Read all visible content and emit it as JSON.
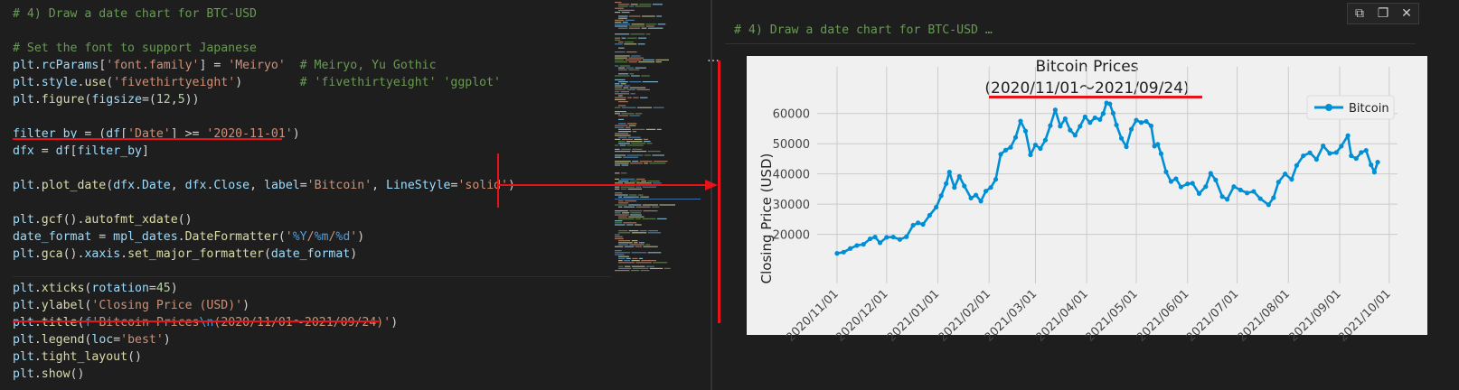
{
  "editor": {
    "lines": [
      [
        {
          "c": "cm",
          "t": "# 4) Draw a date chart for BTC-USD"
        }
      ],
      [],
      [
        {
          "c": "cm",
          "t": "# Set the font to support Japanese"
        }
      ],
      [
        {
          "c": "vr",
          "t": "plt"
        },
        {
          "c": "pl",
          "t": "."
        },
        {
          "c": "vr",
          "t": "rcParams"
        },
        {
          "c": "pl",
          "t": "["
        },
        {
          "c": "st",
          "t": "'font.family'"
        },
        {
          "c": "pl",
          "t": "] = "
        },
        {
          "c": "st",
          "t": "'Meiryo'"
        },
        {
          "c": "pl",
          "t": "  "
        },
        {
          "c": "cm",
          "t": "# Meiryo, Yu Gothic"
        }
      ],
      [
        {
          "c": "vr",
          "t": "plt"
        },
        {
          "c": "pl",
          "t": "."
        },
        {
          "c": "vr",
          "t": "style"
        },
        {
          "c": "pl",
          "t": "."
        },
        {
          "c": "fn",
          "t": "use"
        },
        {
          "c": "pl",
          "t": "("
        },
        {
          "c": "st",
          "t": "'fivethirtyeight'"
        },
        {
          "c": "pl",
          "t": ")        "
        },
        {
          "c": "cm",
          "t": "# 'fivethirtyeight' 'ggplot'"
        }
      ],
      [
        {
          "c": "vr",
          "t": "plt"
        },
        {
          "c": "pl",
          "t": "."
        },
        {
          "c": "fn",
          "t": "figure"
        },
        {
          "c": "pl",
          "t": "("
        },
        {
          "c": "vr",
          "t": "figsize"
        },
        {
          "c": "pl",
          "t": "=("
        },
        {
          "c": "nm",
          "t": "12"
        },
        {
          "c": "pl",
          "t": ","
        },
        {
          "c": "nm",
          "t": "5"
        },
        {
          "c": "pl",
          "t": "))"
        }
      ],
      [],
      [
        {
          "c": "vr",
          "t": "filter_by"
        },
        {
          "c": "pl",
          "t": " = ("
        },
        {
          "c": "vr",
          "t": "df"
        },
        {
          "c": "pl",
          "t": "["
        },
        {
          "c": "st",
          "t": "'Date'"
        },
        {
          "c": "pl",
          "t": "] >= "
        },
        {
          "c": "st",
          "t": "'2020-11-01'"
        },
        {
          "c": "pl",
          "t": ")"
        }
      ],
      [
        {
          "c": "vr",
          "t": "dfx"
        },
        {
          "c": "pl",
          "t": " = "
        },
        {
          "c": "vr",
          "t": "df"
        },
        {
          "c": "pl",
          "t": "["
        },
        {
          "c": "vr",
          "t": "filter_by"
        },
        {
          "c": "pl",
          "t": "]"
        }
      ],
      [],
      [
        {
          "c": "vr",
          "t": "plt"
        },
        {
          "c": "pl",
          "t": "."
        },
        {
          "c": "fn",
          "t": "plot_date"
        },
        {
          "c": "pl",
          "t": "("
        },
        {
          "c": "vr",
          "t": "dfx"
        },
        {
          "c": "pl",
          "t": "."
        },
        {
          "c": "vr",
          "t": "Date"
        },
        {
          "c": "pl",
          "t": ", "
        },
        {
          "c": "vr",
          "t": "dfx"
        },
        {
          "c": "pl",
          "t": "."
        },
        {
          "c": "vr",
          "t": "Close"
        },
        {
          "c": "pl",
          "t": ", "
        },
        {
          "c": "vr",
          "t": "label"
        },
        {
          "c": "pl",
          "t": "="
        },
        {
          "c": "st",
          "t": "'Bitcoin'"
        },
        {
          "c": "pl",
          "t": ", "
        },
        {
          "c": "vr",
          "t": "LineStyle"
        },
        {
          "c": "pl",
          "t": "="
        },
        {
          "c": "st",
          "t": "'solid'"
        },
        {
          "c": "pl",
          "t": ")"
        }
      ],
      [],
      [
        {
          "c": "vr",
          "t": "plt"
        },
        {
          "c": "pl",
          "t": "."
        },
        {
          "c": "fn",
          "t": "gcf"
        },
        {
          "c": "pl",
          "t": "()."
        },
        {
          "c": "fn",
          "t": "autofmt_xdate"
        },
        {
          "c": "pl",
          "t": "()"
        }
      ],
      [
        {
          "c": "vr",
          "t": "date_format"
        },
        {
          "c": "pl",
          "t": " = "
        },
        {
          "c": "vr",
          "t": "mpl_dates"
        },
        {
          "c": "pl",
          "t": "."
        },
        {
          "c": "fn",
          "t": "DateFormatter"
        },
        {
          "c": "pl",
          "t": "("
        },
        {
          "c": "st",
          "t": "'"
        },
        {
          "c": "kw",
          "t": "%Y"
        },
        {
          "c": "st",
          "t": "/"
        },
        {
          "c": "kw",
          "t": "%m"
        },
        {
          "c": "st",
          "t": "/"
        },
        {
          "c": "kw",
          "t": "%d"
        },
        {
          "c": "st",
          "t": "'"
        },
        {
          "c": "pl",
          "t": ")"
        }
      ],
      [
        {
          "c": "vr",
          "t": "plt"
        },
        {
          "c": "pl",
          "t": "."
        },
        {
          "c": "fn",
          "t": "gca"
        },
        {
          "c": "pl",
          "t": "()."
        },
        {
          "c": "vr",
          "t": "xaxis"
        },
        {
          "c": "pl",
          "t": "."
        },
        {
          "c": "fn",
          "t": "set_major_formatter"
        },
        {
          "c": "pl",
          "t": "("
        },
        {
          "c": "vr",
          "t": "date_format"
        },
        {
          "c": "pl",
          "t": ")"
        }
      ],
      [],
      [
        {
          "c": "vr",
          "t": "plt"
        },
        {
          "c": "pl",
          "t": "."
        },
        {
          "c": "fn",
          "t": "xticks"
        },
        {
          "c": "pl",
          "t": "("
        },
        {
          "c": "vr",
          "t": "rotation"
        },
        {
          "c": "pl",
          "t": "="
        },
        {
          "c": "nm",
          "t": "45"
        },
        {
          "c": "pl",
          "t": ")"
        }
      ],
      [
        {
          "c": "vr",
          "t": "plt"
        },
        {
          "c": "pl",
          "t": "."
        },
        {
          "c": "fn",
          "t": "ylabel"
        },
        {
          "c": "pl",
          "t": "("
        },
        {
          "c": "st",
          "t": "'Closing Price (USD)'"
        },
        {
          "c": "pl",
          "t": ")"
        }
      ],
      [
        {
          "c": "vr",
          "t": "plt"
        },
        {
          "c": "pl",
          "t": "."
        },
        {
          "c": "fn",
          "t": "title"
        },
        {
          "c": "pl",
          "t": "("
        },
        {
          "c": "kw",
          "t": "f"
        },
        {
          "c": "st",
          "t": "'Bitcoin Prices"
        },
        {
          "c": "kw",
          "t": "\\n"
        },
        {
          "c": "st",
          "t": "(2020/11/01～2021/09/24)'"
        },
        {
          "c": "pl",
          "t": ")"
        }
      ],
      [
        {
          "c": "vr",
          "t": "plt"
        },
        {
          "c": "pl",
          "t": "."
        },
        {
          "c": "fn",
          "t": "legend"
        },
        {
          "c": "pl",
          "t": "("
        },
        {
          "c": "vr",
          "t": "loc"
        },
        {
          "c": "pl",
          "t": "="
        },
        {
          "c": "st",
          "t": "'best'"
        },
        {
          "c": "pl",
          "t": ")"
        }
      ],
      [
        {
          "c": "vr",
          "t": "plt"
        },
        {
          "c": "pl",
          "t": "."
        },
        {
          "c": "fn",
          "t": "tight_layout"
        },
        {
          "c": "pl",
          "t": "()"
        }
      ],
      [
        {
          "c": "vr",
          "t": "plt"
        },
        {
          "c": "pl",
          "t": "."
        },
        {
          "c": "fn",
          "t": "show"
        },
        {
          "c": "pl",
          "t": "()"
        }
      ]
    ]
  },
  "output": {
    "cell_title": "# 4) Draw a date chart for BTC-USD …",
    "dots": "…",
    "toolbar": {
      "copy_icon": "copy-icon",
      "open_icon": "open-output-icon",
      "close_icon": "close-icon",
      "copy_glyph": "⧉",
      "open_glyph": "❐",
      "close_glyph": "✕"
    }
  },
  "colors": {
    "line": "#008fd5",
    "annotation": "#e8121b",
    "figure_bg": "#f0f0f0",
    "grid": "#cbcbcb"
  },
  "chart_data": {
    "type": "line",
    "title_line1": "Bitcoin Prices",
    "title_line2": "(2020/11/01～2021/09/24)",
    "ylabel": "Closing Price (USD)",
    "xlabel": "",
    "legend": "Bitcoin",
    "legend_position": "top-right",
    "grid": true,
    "ylim": [
      11500,
      66500
    ],
    "xlim": [
      "2020-10-20",
      "2021-10-06"
    ],
    "yticks": [
      20000,
      30000,
      40000,
      50000,
      60000
    ],
    "xticks": [
      "2020-11-01",
      "2020-12-01",
      "2021-01-01",
      "2021-02-01",
      "2021-03-01",
      "2021-04-01",
      "2021-05-01",
      "2021-06-01",
      "2021-07-01",
      "2021-08-01",
      "2021-09-01",
      "2021-10-01"
    ],
    "xtick_labels": [
      "2020/11/01",
      "2020/12/01",
      "2021/01/01",
      "2021/02/01",
      "2021/03/01",
      "2021/04/01",
      "2021/05/01",
      "2021/06/01",
      "2021/07/01",
      "2021/08/01",
      "2021/09/01",
      "2021/10/01"
    ],
    "series": [
      {
        "name": "Bitcoin",
        "x": [
          "2020-11-01",
          "2020-11-05",
          "2020-11-09",
          "2020-11-13",
          "2020-11-17",
          "2020-11-21",
          "2020-11-24",
          "2020-11-27",
          "2020-12-01",
          "2020-12-05",
          "2020-12-09",
          "2020-12-13",
          "2020-12-17",
          "2020-12-20",
          "2020-12-23",
          "2020-12-27",
          "2020-12-31",
          "2021-01-03",
          "2021-01-06",
          "2021-01-08",
          "2021-01-11",
          "2021-01-14",
          "2021-01-17",
          "2021-01-21",
          "2021-01-24",
          "2021-01-27",
          "2021-01-30",
          "2021-02-02",
          "2021-02-05",
          "2021-02-08",
          "2021-02-11",
          "2021-02-14",
          "2021-02-17",
          "2021-02-20",
          "2021-02-23",
          "2021-02-26",
          "2021-03-01",
          "2021-03-04",
          "2021-03-07",
          "2021-03-10",
          "2021-03-13",
          "2021-03-16",
          "2021-03-19",
          "2021-03-22",
          "2021-03-25",
          "2021-03-28",
          "2021-03-31",
          "2021-04-03",
          "2021-04-06",
          "2021-04-09",
          "2021-04-11",
          "2021-04-13",
          "2021-04-15",
          "2021-04-17",
          "2021-04-19",
          "2021-04-22",
          "2021-04-25",
          "2021-04-28",
          "2021-05-01",
          "2021-05-04",
          "2021-05-07",
          "2021-05-10",
          "2021-05-12",
          "2021-05-14",
          "2021-05-16",
          "2021-05-19",
          "2021-05-22",
          "2021-05-25",
          "2021-05-28",
          "2021-06-01",
          "2021-06-04",
          "2021-06-08",
          "2021-06-12",
          "2021-06-15",
          "2021-06-18",
          "2021-06-22",
          "2021-06-25",
          "2021-06-29",
          "2021-07-03",
          "2021-07-07",
          "2021-07-11",
          "2021-07-15",
          "2021-07-20",
          "2021-07-23",
          "2021-07-26",
          "2021-07-30",
          "2021-08-03",
          "2021-08-06",
          "2021-08-10",
          "2021-08-14",
          "2021-08-18",
          "2021-08-22",
          "2021-08-26",
          "2021-08-30",
          "2021-09-02",
          "2021-09-06",
          "2021-09-08",
          "2021-09-11",
          "2021-09-14",
          "2021-09-17",
          "2021-09-20",
          "2021-09-22",
          "2021-09-24"
        ],
        "y": [
          13700,
          14100,
          15300,
          16300,
          16700,
          18500,
          19100,
          17200,
          19000,
          19100,
          18300,
          19200,
          23000,
          23800,
          23300,
          26300,
          29000,
          32800,
          36800,
          40600,
          35500,
          39200,
          36000,
          32000,
          33000,
          31000,
          34300,
          35500,
          38200,
          46500,
          47900,
          48800,
          52100,
          57500,
          54200,
          46300,
          49600,
          48400,
          51200,
          56000,
          61200,
          55800,
          58300,
          54500,
          52800,
          55800,
          58900,
          57000,
          58600,
          58000,
          60000,
          63500,
          63200,
          60100,
          56200,
          51800,
          49000,
          54800,
          57800,
          57000,
          57400,
          55900,
          49200,
          49800,
          46700,
          40700,
          37500,
          38400,
          35700,
          36700,
          36900,
          33500,
          35800,
          40200,
          38000,
          32500,
          31600,
          35800,
          34700,
          33700,
          34200,
          31800,
          29800,
          32100,
          37300,
          40000,
          38200,
          42800,
          46000,
          47000,
          44800,
          49300,
          46800,
          47100,
          49200,
          52700,
          46000,
          45100,
          47100,
          47800,
          43000,
          40600,
          43900
        ]
      }
    ]
  }
}
